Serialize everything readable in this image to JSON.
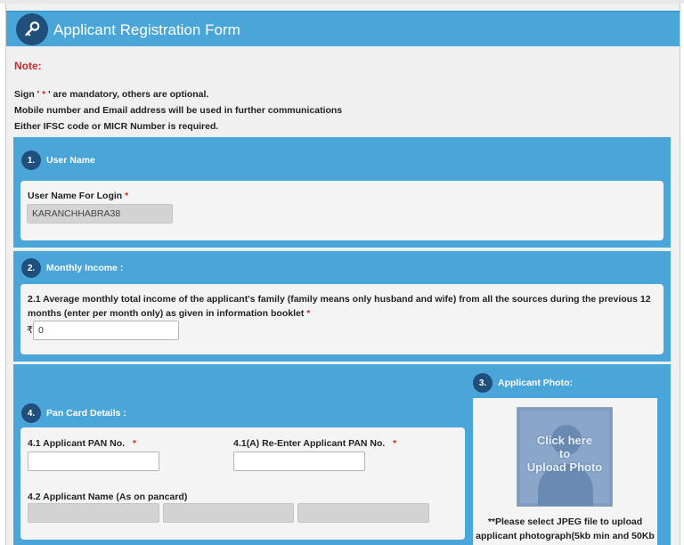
{
  "header": {
    "title": "Applicant Registration Form",
    "icon": "key-icon"
  },
  "note": {
    "title": "Note:",
    "line1_pre": "Sign '",
    "line1_star": " * ",
    "line1_post": "' are mandatory, others are optional.",
    "line2": "Mobile number and Email address will be used in further communications",
    "line3": "Either IFSC code or MICR Number is required."
  },
  "section1": {
    "number": "1.",
    "title": "User Name",
    "field_label": "User Name For Login",
    "required": "*",
    "value": "KARANCHHABRA38"
  },
  "section2": {
    "number": "2.",
    "title": "Monthly Income :",
    "question": "2.1 Average monthly total income of the applicant's family (family means only husband and wife) from all the sources during the previous 12 months (enter per month only) as given in information booklet",
    "required": "*",
    "currency": "₹",
    "value": "0"
  },
  "section3": {
    "number": "3.",
    "title": "Applicant Photo:",
    "upload_line1": "Click here",
    "upload_line2": "to",
    "upload_line3": "Upload Photo",
    "hint_line1": "**Please select JPEG file to upload",
    "hint_line2": "applicant photograph(5kb min and 50Kb"
  },
  "section4": {
    "number": "4.",
    "title": "Pan Card Details :",
    "pan_label": "4.1 Applicant PAN No.",
    "pan_required": "*",
    "repan_label": "4.1(A) Re-Enter Applicant PAN No.",
    "repan_required": "*",
    "name_label": "4.2 Applicant Name (As on pancard)"
  },
  "colors": {
    "header_blue": "#4aa6d8",
    "badge_navy": "#1f4f7a",
    "required_red": "#d42828"
  }
}
